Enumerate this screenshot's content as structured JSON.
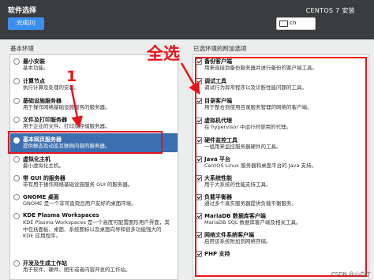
{
  "header": {
    "page_title": "软件选择",
    "done_label": "完成(D)",
    "product_title": "CENTOS 7 安装",
    "keyboard_layout": "cn"
  },
  "left_section": {
    "title": "基本环境",
    "items": [
      {
        "name": "最小安装",
        "desc": "基本功能。",
        "checked": false
      },
      {
        "name": "计算节点",
        "desc": "执行计算及处理的安装。",
        "checked": false
      },
      {
        "name": "基础设施服务器",
        "desc": "用于操作网络基础设施服务的服务器。",
        "checked": false
      },
      {
        "name": "文件及打印服务器",
        "desc": "用于企业的文件、打印及存储服务器。",
        "checked": false
      },
      {
        "name": "基本网页服务器",
        "desc": "提供静态及动态互联网内容的服务器。",
        "checked": true
      },
      {
        "name": "虚拟化主机",
        "desc": "最小虚拟化主机。",
        "checked": false
      },
      {
        "name": "带 GUI 的服务器",
        "desc": "带有用于操作网络基础设施服务 GUI 的服务器。",
        "checked": false
      },
      {
        "name": "GNOME 桌面",
        "desc": "GNOME 是一个非常直观且用户友好的桌面环境。",
        "checked": false
      },
      {
        "name": "KDE Plasma Workspaces",
        "desc": "KDE Plasma Workspaces 是一个高度可配置图形用户界面，其中包括面板、桌面、系统图标以及桌面向导和很多功能强大的 KDE 应用程序。",
        "checked": false
      },
      {
        "name": "开发及生成工作站",
        "desc": "用于软件、硬件、图形或者内容开发的工作站。",
        "checked": false
      }
    ]
  },
  "right_section": {
    "title": "已选环境的附加选项",
    "items": [
      {
        "name": "备份客户端",
        "desc": "用来连接到备份服务器并进行备份的客户端工具。"
      },
      {
        "name": "调试工具",
        "desc": "调试行为异常程序以及诊断性能问题的工具。"
      },
      {
        "name": "目录客户端",
        "desc": "用于整合到使用目录服务管理的网络的客户端。"
      },
      {
        "name": "虚拟机代理",
        "desc": "在 hypervisor 中运行时使用的代理。"
      },
      {
        "name": "硬件监控工具",
        "desc": "一组用来监控服务器硬件的工具。"
      },
      {
        "name": "Java 平台",
        "desc": "CentOS Linux 服务器和桌面平台的 Java 支持。"
      },
      {
        "name": "大系统性能",
        "desc": "用于大系统的性能支持工具。"
      },
      {
        "name": "负载平衡器",
        "desc": "通过多个真实服务器提供负载平衡服务。"
      },
      {
        "name": "MariaDB 数据库客户端",
        "desc": "MariaDB SQL 数据库客户端及相关工具。"
      },
      {
        "name": "网络文件系统客户端",
        "desc": "启用该系统附加到网络存储。"
      },
      {
        "name": "PHP 支持",
        "desc": ""
      }
    ]
  },
  "annotations": {
    "select_all_text": "全选",
    "step_number": "1"
  },
  "watermark": "CSDN @小白丁",
  "colors": {
    "accent": "#3b8ef0",
    "selection": "#3b6fb0",
    "annotation": "#e8141a"
  }
}
